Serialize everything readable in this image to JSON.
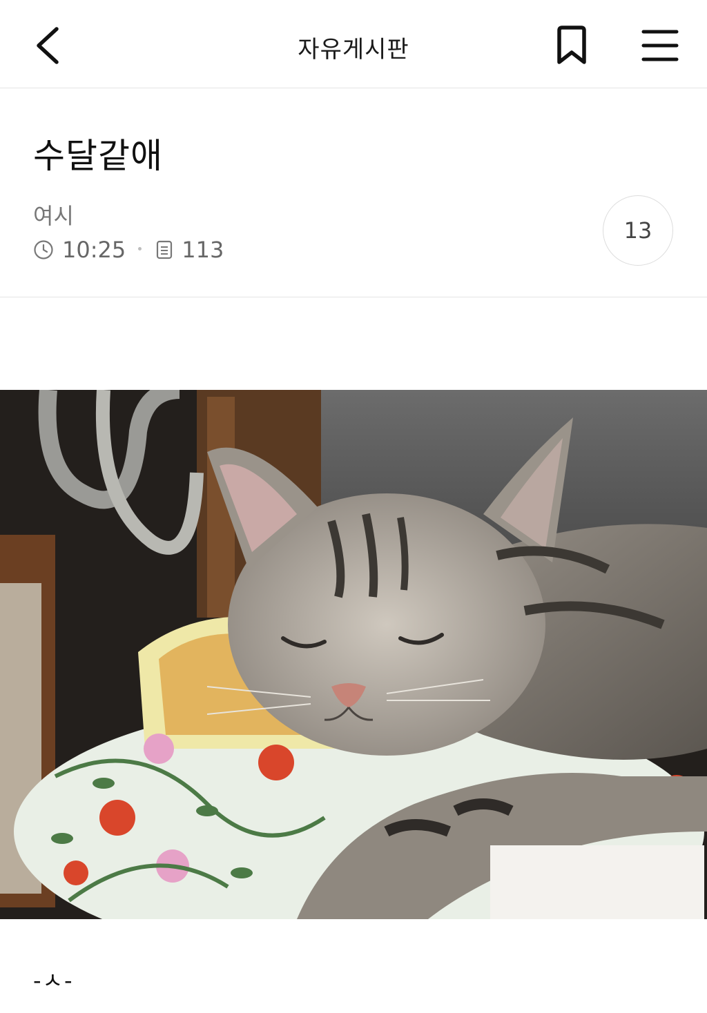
{
  "topbar": {
    "board_title": "자유게시판",
    "back_icon": "chevron-left-icon",
    "bookmark_icon": "bookmark-icon",
    "menu_icon": "hamburger-menu-icon"
  },
  "post": {
    "title": "수달같애",
    "author": "여시",
    "time": "10:25",
    "views": "113",
    "comment_count": "13",
    "body_text": "-ㅅ-"
  },
  "image": {
    "subject": "sleeping silver tabby cat on a floral cat bed"
  },
  "colors": {
    "text": "#111111",
    "muted": "#777777",
    "divider": "#e4e4e4"
  }
}
